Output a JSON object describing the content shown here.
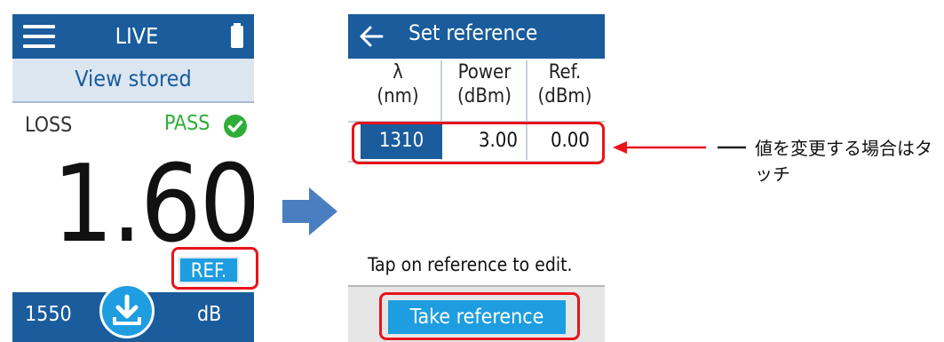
{
  "live_screen": {
    "title": "LIVE",
    "view_stored": "View stored",
    "loss_label": "LOSS",
    "pass_label": "PASS",
    "loss_value": "1.60",
    "ref_button": "REF.",
    "wavelength": "1550",
    "unit": "dB"
  },
  "reference_screen": {
    "title": "Set reference",
    "columns": [
      {
        "line1": "λ",
        "line2": "(nm)"
      },
      {
        "line1": "Power",
        "line2": "(dBm)"
      },
      {
        "line1": "Ref.",
        "line2": "(dBm)"
      }
    ],
    "row": {
      "wavelength": "1310",
      "power": "3.00",
      "ref": "0.00"
    },
    "hint": "Tap on reference to edit.",
    "take_reference_button": "Take reference"
  },
  "annotation": {
    "text": "値を変更する場合はタッチ"
  },
  "colors": {
    "header_blue": "#1a5c9c",
    "button_blue": "#1e9de0",
    "pass_green": "#2eae39",
    "highlight_red": "#e8141b",
    "flow_arrow": "#4a7ec0"
  }
}
